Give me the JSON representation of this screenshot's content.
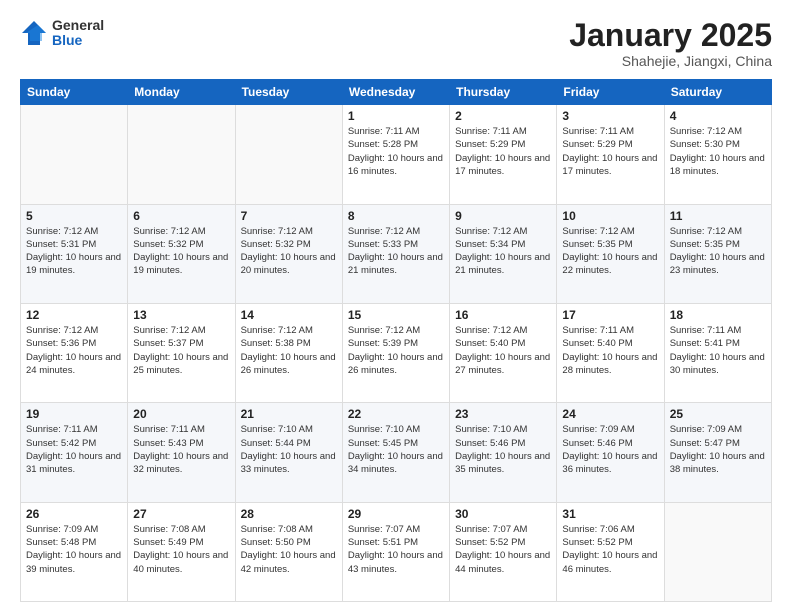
{
  "header": {
    "logo": {
      "general": "General",
      "blue": "Blue"
    },
    "title": "January 2025",
    "location": "Shahejie, Jiangxi, China"
  },
  "weekdays": [
    "Sunday",
    "Monday",
    "Tuesday",
    "Wednesday",
    "Thursday",
    "Friday",
    "Saturday"
  ],
  "weeks": [
    [
      {
        "day": "",
        "empty": true
      },
      {
        "day": "",
        "empty": true
      },
      {
        "day": "",
        "empty": true
      },
      {
        "day": "1",
        "sunrise": "7:11 AM",
        "sunset": "5:28 PM",
        "daylight": "10 hours and 16 minutes."
      },
      {
        "day": "2",
        "sunrise": "7:11 AM",
        "sunset": "5:29 PM",
        "daylight": "10 hours and 17 minutes."
      },
      {
        "day": "3",
        "sunrise": "7:11 AM",
        "sunset": "5:29 PM",
        "daylight": "10 hours and 17 minutes."
      },
      {
        "day": "4",
        "sunrise": "7:12 AM",
        "sunset": "5:30 PM",
        "daylight": "10 hours and 18 minutes."
      }
    ],
    [
      {
        "day": "5",
        "sunrise": "7:12 AM",
        "sunset": "5:31 PM",
        "daylight": "10 hours and 19 minutes."
      },
      {
        "day": "6",
        "sunrise": "7:12 AM",
        "sunset": "5:32 PM",
        "daylight": "10 hours and 19 minutes."
      },
      {
        "day": "7",
        "sunrise": "7:12 AM",
        "sunset": "5:32 PM",
        "daylight": "10 hours and 20 minutes."
      },
      {
        "day": "8",
        "sunrise": "7:12 AM",
        "sunset": "5:33 PM",
        "daylight": "10 hours and 21 minutes."
      },
      {
        "day": "9",
        "sunrise": "7:12 AM",
        "sunset": "5:34 PM",
        "daylight": "10 hours and 21 minutes."
      },
      {
        "day": "10",
        "sunrise": "7:12 AM",
        "sunset": "5:35 PM",
        "daylight": "10 hours and 22 minutes."
      },
      {
        "day": "11",
        "sunrise": "7:12 AM",
        "sunset": "5:35 PM",
        "daylight": "10 hours and 23 minutes."
      }
    ],
    [
      {
        "day": "12",
        "sunrise": "7:12 AM",
        "sunset": "5:36 PM",
        "daylight": "10 hours and 24 minutes."
      },
      {
        "day": "13",
        "sunrise": "7:12 AM",
        "sunset": "5:37 PM",
        "daylight": "10 hours and 25 minutes."
      },
      {
        "day": "14",
        "sunrise": "7:12 AM",
        "sunset": "5:38 PM",
        "daylight": "10 hours and 26 minutes."
      },
      {
        "day": "15",
        "sunrise": "7:12 AM",
        "sunset": "5:39 PM",
        "daylight": "10 hours and 26 minutes."
      },
      {
        "day": "16",
        "sunrise": "7:12 AM",
        "sunset": "5:40 PM",
        "daylight": "10 hours and 27 minutes."
      },
      {
        "day": "17",
        "sunrise": "7:11 AM",
        "sunset": "5:40 PM",
        "daylight": "10 hours and 28 minutes."
      },
      {
        "day": "18",
        "sunrise": "7:11 AM",
        "sunset": "5:41 PM",
        "daylight": "10 hours and 30 minutes."
      }
    ],
    [
      {
        "day": "19",
        "sunrise": "7:11 AM",
        "sunset": "5:42 PM",
        "daylight": "10 hours and 31 minutes."
      },
      {
        "day": "20",
        "sunrise": "7:11 AM",
        "sunset": "5:43 PM",
        "daylight": "10 hours and 32 minutes."
      },
      {
        "day": "21",
        "sunrise": "7:10 AM",
        "sunset": "5:44 PM",
        "daylight": "10 hours and 33 minutes."
      },
      {
        "day": "22",
        "sunrise": "7:10 AM",
        "sunset": "5:45 PM",
        "daylight": "10 hours and 34 minutes."
      },
      {
        "day": "23",
        "sunrise": "7:10 AM",
        "sunset": "5:46 PM",
        "daylight": "10 hours and 35 minutes."
      },
      {
        "day": "24",
        "sunrise": "7:09 AM",
        "sunset": "5:46 PM",
        "daylight": "10 hours and 36 minutes."
      },
      {
        "day": "25",
        "sunrise": "7:09 AM",
        "sunset": "5:47 PM",
        "daylight": "10 hours and 38 minutes."
      }
    ],
    [
      {
        "day": "26",
        "sunrise": "7:09 AM",
        "sunset": "5:48 PM",
        "daylight": "10 hours and 39 minutes."
      },
      {
        "day": "27",
        "sunrise": "7:08 AM",
        "sunset": "5:49 PM",
        "daylight": "10 hours and 40 minutes."
      },
      {
        "day": "28",
        "sunrise": "7:08 AM",
        "sunset": "5:50 PM",
        "daylight": "10 hours and 42 minutes."
      },
      {
        "day": "29",
        "sunrise": "7:07 AM",
        "sunset": "5:51 PM",
        "daylight": "10 hours and 43 minutes."
      },
      {
        "day": "30",
        "sunrise": "7:07 AM",
        "sunset": "5:52 PM",
        "daylight": "10 hours and 44 minutes."
      },
      {
        "day": "31",
        "sunrise": "7:06 AM",
        "sunset": "5:52 PM",
        "daylight": "10 hours and 46 minutes."
      },
      {
        "day": "",
        "empty": true
      }
    ]
  ],
  "colors": {
    "header_bg": "#1565c0",
    "accent": "#1565c0"
  },
  "labels": {
    "sunrise_prefix": "Sunrise: ",
    "sunset_prefix": "Sunset: ",
    "daylight_prefix": "Daylight: "
  }
}
